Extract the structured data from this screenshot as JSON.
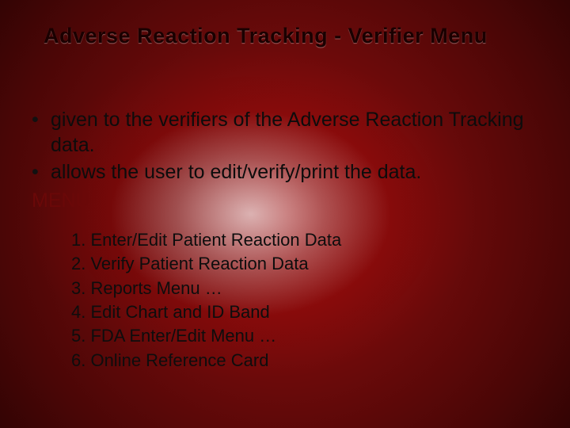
{
  "title": "Adverse Reaction Tracking - Verifier Menu",
  "bullets": [
    "given to the verifiers of the Adverse Reaction Tracking data.",
    "allows the user to edit/verify/print the data."
  ],
  "menu_label": "MENU",
  "menu_items": [
    "1. Enter/Edit Patient Reaction Data",
    "2. Verify Patient Reaction Data",
    "3. Reports Menu …",
    "4. Edit Chart and ID Band",
    "5. FDA Enter/Edit Menu …",
    "6. Online Reference Card"
  ]
}
